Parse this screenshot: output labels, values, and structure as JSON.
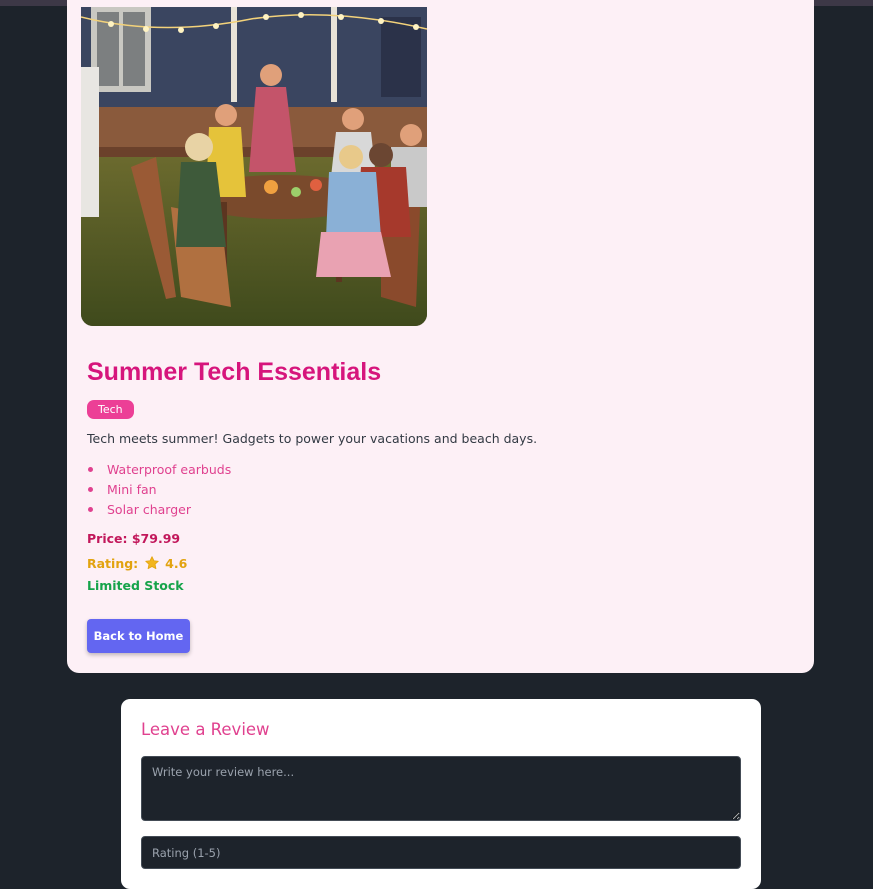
{
  "product": {
    "image_alt": "Friends and family dining outdoors on a summer evening",
    "title": "Summer Tech Essentials",
    "tag": "Tech",
    "description": "Tech meets summer! Gadgets to power your vacations and beach days.",
    "features": [
      "Waterproof earbuds",
      "Mini fan",
      "Solar charger"
    ],
    "price_label": "Price: $79.99",
    "rating_label": "Rating:",
    "rating_value": "4.6",
    "stock_status": "Limited Stock",
    "back_button_label": "Back to Home"
  },
  "review_form": {
    "title": "Leave a Review",
    "review_placeholder": "Write your review here...",
    "rating_placeholder": "Rating (1-5)"
  },
  "icons": {
    "rating": "star-icon"
  },
  "colors": {
    "page_background": "#1d232b",
    "card_background": "#fdf0f6",
    "title": "#d6157c",
    "accent_pink": "#ec3f96",
    "price": "#c2185b",
    "rating": "#e2a30f",
    "stock": "#16a34a",
    "button": "#6366f1"
  }
}
